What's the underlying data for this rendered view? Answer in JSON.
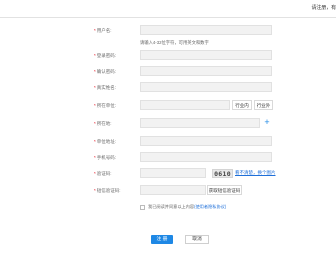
{
  "topbar": {
    "tip": "请注册，有"
  },
  "form": {
    "username": {
      "label": "用户名:",
      "hint": "请输入4-32位字符，可用英文和数字"
    },
    "password": {
      "label": "登录密码:"
    },
    "confirm": {
      "label": "确认密码:"
    },
    "realname": {
      "label": "真实姓名:"
    },
    "unit": {
      "label": "所在单位:",
      "btn1": "行业内",
      "btn2": "行业外"
    },
    "region": {
      "label": "所在地:"
    },
    "address": {
      "label": "单位地址:"
    },
    "mobile": {
      "label": "手机号码:"
    },
    "captcha": {
      "label": "验证码:",
      "code": "0610",
      "link": "看不清楚，换个图片"
    },
    "sms": {
      "label": "短信验证码:",
      "button": "获取短信验证码"
    },
    "agreement": {
      "text": "我已阅读并同意以上内容",
      "link": "(使用者隐私协议)"
    }
  },
  "buttons": {
    "submit": "注 册",
    "cancel": "取消"
  }
}
